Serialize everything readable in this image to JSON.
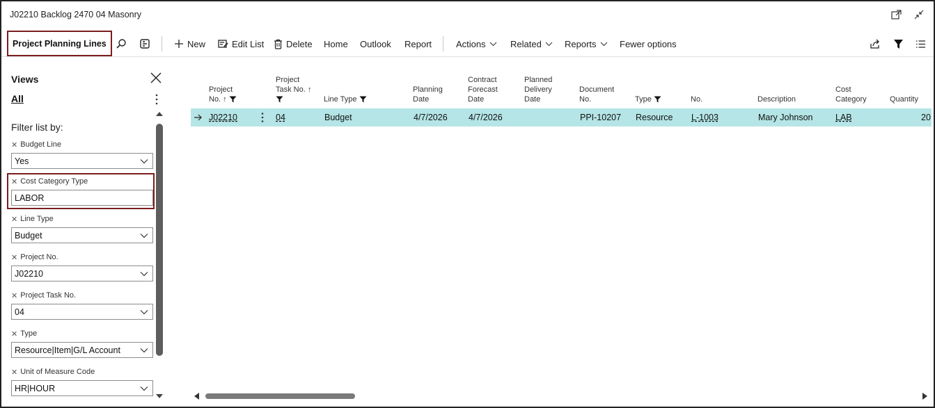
{
  "window": {
    "title": "J02210 Backlog 2470 04 Masonry"
  },
  "actionbar": {
    "page_title": "Project Planning Lines",
    "new": "New",
    "edit_list": "Edit List",
    "delete": "Delete",
    "home": "Home",
    "outlook": "Outlook",
    "report": "Report",
    "actions": "Actions",
    "related": "Related",
    "reports": "Reports",
    "fewer_options": "Fewer options"
  },
  "filterpane": {
    "views": "Views",
    "all": "All",
    "filter_list_by": "Filter list by:",
    "filters": [
      {
        "label": "Budget Line",
        "value": "Yes"
      },
      {
        "label": "Cost Category Type",
        "value": "LABOR"
      },
      {
        "label": "Line Type",
        "value": "Budget"
      },
      {
        "label": "Project No.",
        "value": "J02210"
      },
      {
        "label": "Project Task No.",
        "value": "04"
      },
      {
        "label": "Type",
        "value": "Resource|Item|G/L Account"
      },
      {
        "label": "Unit of Measure Code",
        "value": "HR|HOUR"
      }
    ]
  },
  "grid": {
    "headers": {
      "project_no_1": "Project",
      "project_no_2": "No. ↑",
      "task_no_1": "Project",
      "task_no_2": "Task No. ↑",
      "line_type": "Line Type",
      "planning_date_1": "Planning",
      "planning_date_2": "Date",
      "contract_1": "Contract",
      "contract_2": "Forecast",
      "contract_3": "Date",
      "planned_1": "Planned",
      "planned_2": "Delivery",
      "planned_3": "Date",
      "document_1": "Document",
      "document_2": "No.",
      "type": "Type",
      "no": "No.",
      "description": "Description",
      "cost_1": "Cost",
      "cost_2": "Category",
      "quantity": "Quantity"
    },
    "row": {
      "project_no": "J02210",
      "task_no": "04",
      "line_type": "Budget",
      "planning_date": "4/7/2026",
      "contract_date": "4/7/2026",
      "planned_date": "",
      "document_no": "PPI-10207",
      "type": "Resource",
      "no": "L-1003",
      "description": "Mary Johnson",
      "cost_category": "LAB",
      "quantity": "20"
    }
  }
}
